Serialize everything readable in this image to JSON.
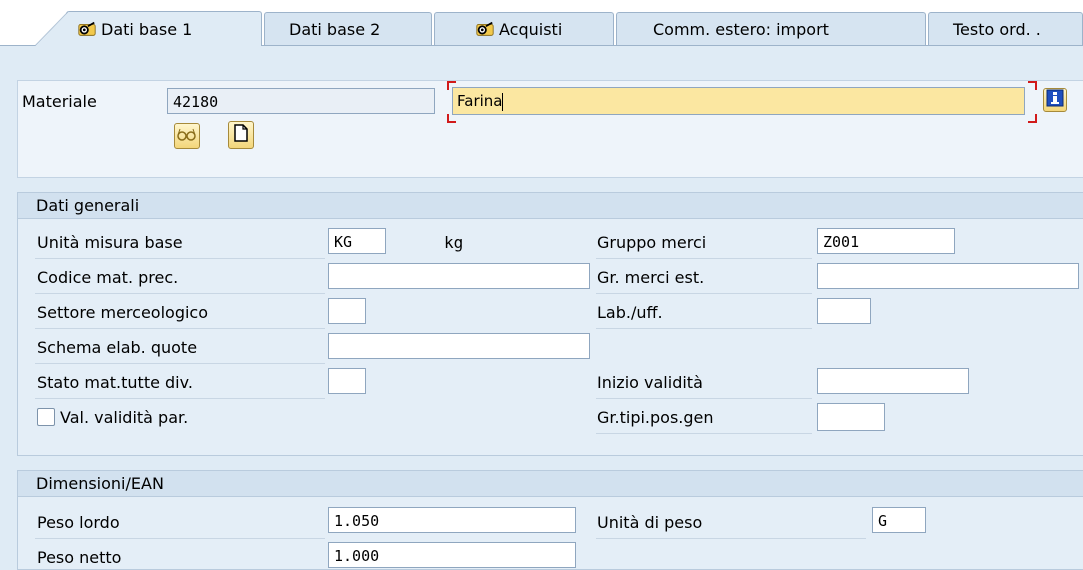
{
  "tabs": [
    {
      "label": "Dati base 1",
      "icon": "glasses-icon",
      "active": true
    },
    {
      "label": "Dati base 2",
      "icon": null,
      "active": false
    },
    {
      "label": "Acquisti",
      "icon": "glasses-icon",
      "active": false
    },
    {
      "label": "Comm. estero: import",
      "icon": null,
      "active": false
    },
    {
      "label": "Testo ord. .",
      "icon": null,
      "active": false
    }
  ],
  "header": {
    "material_label": "Materiale",
    "material_value": "42180",
    "description_value": "Farina",
    "info_icon": "info-icon",
    "display_icon": "glasses-icon",
    "document_icon": "document-icon"
  },
  "general": {
    "title": "Dati generali",
    "fields": {
      "base_uom_label": "Unità misura base",
      "base_uom_value": "KG",
      "base_uom_text": "kg",
      "old_material_label": "Codice mat. prec.",
      "old_material_value": "",
      "division_label": "Settore merceologico",
      "division_value": "",
      "quota_label": "Schema elab. quote",
      "quota_value": "",
      "status_label": "Stato mat.tutte div.",
      "status_value": "",
      "valid_par_label": "Val. validità par.",
      "material_group_label": "Gruppo merci",
      "material_group_value": "Z001",
      "ext_group_label": "Gr. merci est.",
      "ext_group_value": "",
      "lab_label": "Lab./uff.",
      "lab_value": "",
      "valid_from_label": "Inizio validità",
      "valid_from_value": "",
      "item_cat_label": "Gr.tipi.pos.gen",
      "item_cat_value": ""
    }
  },
  "dimensions": {
    "title": "Dimensioni/EAN",
    "gross_label": "Peso lordo",
    "gross_value": "1.050",
    "net_label": "Peso netto",
    "net_value": "1.000",
    "weight_unit_label": "Unità di peso",
    "weight_unit_value": "G"
  },
  "colors": {
    "background": "#dfebf5",
    "highlight_field": "#fbe7a1",
    "focus_marker": "#d11a1a"
  }
}
